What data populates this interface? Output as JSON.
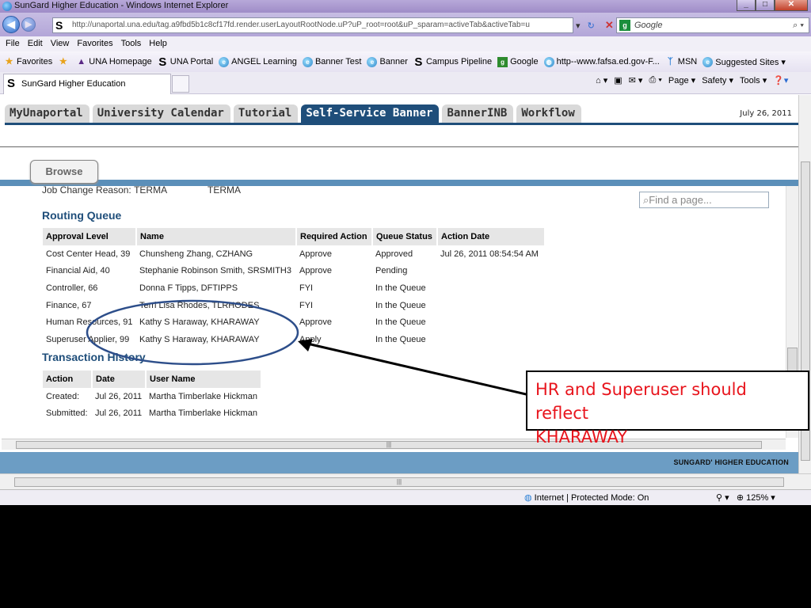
{
  "browser": {
    "title": "SunGard Higher Education - Windows Internet Explorer",
    "url": "http://unaportal.una.edu/tag.a9fbd5b1c8cf17fd.render.userLayoutRootNode.uP?uP_root=root&uP_sparam=activeTab&activeTab=u",
    "search_placeholder": "Google",
    "menu": [
      "File",
      "Edit",
      "View",
      "Favorites",
      "Tools",
      "Help"
    ],
    "favorites_label": "Favorites",
    "favorites": [
      "UNA Homepage",
      "UNA Portal",
      "ANGEL Learning",
      "Banner Test",
      "Banner",
      "Campus Pipeline",
      "Google",
      "http--www.fafsa.ed.gov-F...",
      "MSN",
      "Suggested Sites ▾"
    ],
    "tab_title": "SunGard Higher Education",
    "commands": [
      "Page ▾",
      "Safety ▾",
      "Tools ▾"
    ],
    "status_zone": "Internet | Protected Mode: On",
    "zoom": "125%"
  },
  "portal": {
    "tabs": [
      "MyUnaportal",
      "University Calendar",
      "Tutorial",
      "Self-Service Banner",
      "BannerINB",
      "Workflow"
    ],
    "active_tab_index": 3,
    "date": "July 26, 2011",
    "browse_label": "Browse",
    "find_placeholder": "Find a page...",
    "footer_logo": "SUNGARD' HIGHER EDUCATION"
  },
  "job_change": {
    "label": "Job Change Reason:",
    "value1": "TERMA",
    "value2": "TERMA"
  },
  "routing_queue": {
    "title": "Routing Queue",
    "columns": [
      "Approval Level",
      "Name",
      "Required Action",
      "Queue Status",
      "Action Date"
    ],
    "rows": [
      [
        "Cost Center Head, 39",
        "Chunsheng Zhang, CZHANG",
        "Approve",
        "Approved",
        "Jul 26, 2011 08:54:54 AM"
      ],
      [
        "Financial Aid, 40",
        "Stephanie Robinson Smith, SRSMITH3",
        "Approve",
        "Pending",
        ""
      ],
      [
        "Controller, 66",
        "Donna F Tipps, DFTIPPS",
        "FYI",
        "In the Queue",
        ""
      ],
      [
        "Finance, 67",
        "Terri Lisa Rhodes, TLRHODES",
        "FYI",
        "In the Queue",
        ""
      ],
      [
        "Human Resources, 91",
        "Kathy S Haraway, KHARAWAY",
        "Approve",
        "In the Queue",
        ""
      ],
      [
        "Superuser Applier, 99",
        "Kathy S Haraway, KHARAWAY",
        "Apply",
        "In the Queue",
        ""
      ]
    ]
  },
  "transaction_history": {
    "title": "Transaction History",
    "columns": [
      "Action",
      "Date",
      "User Name"
    ],
    "rows": [
      [
        "Created:",
        "Jul 26, 2011",
        "Martha Timberlake Hickman"
      ],
      [
        "Submitted:",
        "Jul 26, 2011",
        "Martha Timberlake Hickman"
      ]
    ]
  },
  "annotation": {
    "line1": "HR and Superuser should reflect",
    "line2": "KHARAWAY",
    "color": "#e8141c"
  }
}
